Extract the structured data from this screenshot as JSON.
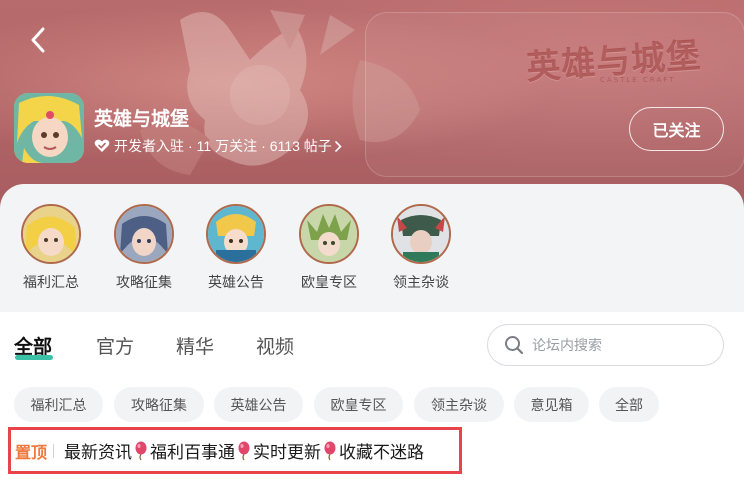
{
  "header": {
    "game_title": "英雄与城堡",
    "meta_badge_icon": "verified-heart-icon",
    "meta_developer": "开发者入驻",
    "meta_followers": "11 万关注",
    "meta_posts": "6113 帖子",
    "meta_separator": "·",
    "follow_label": "已关注",
    "banner_logo": "英雄与城堡",
    "banner_logo_sub": "CASTLE CRAFT"
  },
  "categories": [
    {
      "label": "福利汇总",
      "icon": "hero-avatar-blonde"
    },
    {
      "label": "攻略征集",
      "icon": "hero-avatar-elf"
    },
    {
      "label": "英雄公告",
      "icon": "hero-avatar-armored"
    },
    {
      "label": "欧皇专区",
      "icon": "hero-avatar-druid"
    },
    {
      "label": "领主杂谈",
      "icon": "hero-avatar-warrior"
    }
  ],
  "tabs": [
    {
      "label": "全部",
      "active": true
    },
    {
      "label": "官方",
      "active": false
    },
    {
      "label": "精华",
      "active": false
    },
    {
      "label": "视频",
      "active": false
    }
  ],
  "search": {
    "placeholder": "论坛内搜索"
  },
  "chips": [
    "福利汇总",
    "攻略征集",
    "英雄公告",
    "欧皇专区",
    "领主杂谈",
    "意见箱",
    "全部"
  ],
  "pinned": {
    "tag": "置顶",
    "segments": [
      "最新资讯",
      "福利百事通",
      "实时更新",
      "收藏不迷路"
    ]
  },
  "colors": {
    "accent": "#3bc1a6",
    "pin_tag": "#f07a3d",
    "highlight_border": "#e8454a",
    "banner": "#b06466"
  }
}
